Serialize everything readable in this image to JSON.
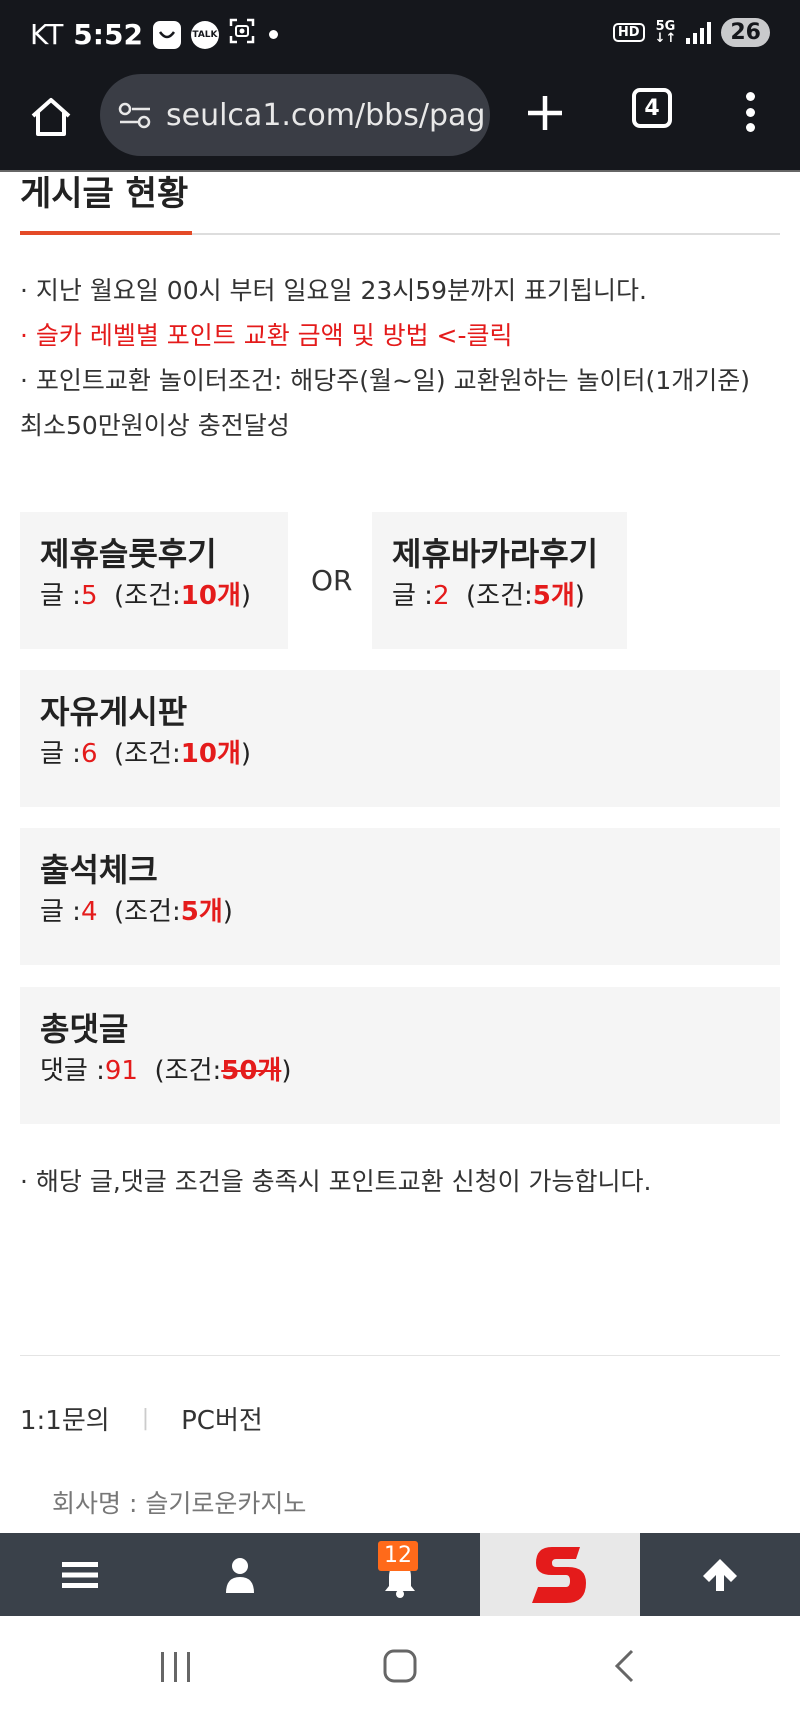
{
  "status_bar": {
    "carrier": "KT",
    "time": "5:52",
    "talk_label": "TALK",
    "hd_label": "HD",
    "network": "5G",
    "battery": "26"
  },
  "browser": {
    "url": "seulca1.com/bbs/pag",
    "tab_count": "4"
  },
  "section": {
    "title": "게시글 현황",
    "notes": [
      "· 지난 월요일 00시 부터 일요일 23시59분까지 표기됩니다.",
      "· 슬카 레벨별 포인트 교환 금액 및 방법 <-클릭",
      "· 포인트교환 놀이터조건: 해당주(월~일) 교환원하는 놀이터(1개기준) 최소50만원이상 충전달성"
    ]
  },
  "cards": {
    "slot": {
      "title": "제휴슬롯후기",
      "count_label": "글 :",
      "count": "5",
      "cond_open": "(조건:",
      "cond_value": "10개",
      "cond_close": ")"
    },
    "or_label": "OR",
    "baccarat": {
      "title": "제휴바카라후기",
      "count_label": "글 :",
      "count": "2",
      "cond_open": "(조건:",
      "cond_value": "5개",
      "cond_close": ")"
    },
    "free": {
      "title": "자유게시판",
      "count_label": "글 :",
      "count": "6",
      "cond_open": "(조건:",
      "cond_value": "10개",
      "cond_close": ")"
    },
    "attendance": {
      "title": "출석체크",
      "count_label": "글 :",
      "count": "4",
      "cond_open": "(조건:",
      "cond_value": "5개",
      "cond_close": ")"
    },
    "comments": {
      "title": "총댓글",
      "count_label": "댓글 :",
      "count": "91",
      "cond_open": "(조건:",
      "cond_value": "50개",
      "cond_close": ")"
    }
  },
  "footer": {
    "note": "· 해당 글,댓글 조건을 충족시 포인트교환 신청이 가능합니다.",
    "inquiry_link": "1:1문의",
    "separator": "|",
    "pc_link": "PC버전",
    "company": "회사명 : 슬기로운카지노"
  },
  "app_nav": {
    "notification_count": "12",
    "items": [
      "menu-icon",
      "user-icon",
      "bell-icon",
      "site-logo",
      "arrow-up-icon"
    ]
  },
  "colors": {
    "accent": "#e44a27",
    "highlight_red": "#e41b1b",
    "nav_bg": "#3a414a",
    "badge_orange": "#ff6a1a"
  }
}
